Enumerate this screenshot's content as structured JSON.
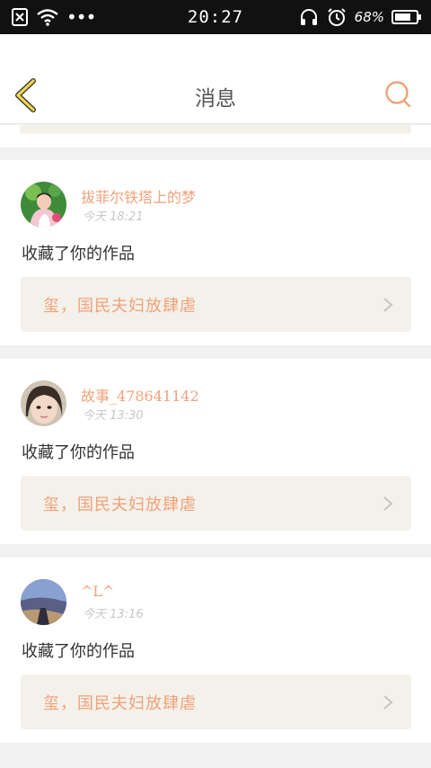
{
  "status_bar": {
    "time": "20:27",
    "battery_text": "68%",
    "icons": [
      "sim-error-icon",
      "wifi-icon",
      "more-dots-icon",
      "headset-icon",
      "alarm-icon",
      "battery-icon"
    ]
  },
  "header": {
    "title": "消息",
    "back_icon": "chevron-left-icon",
    "search_icon": "search-icon"
  },
  "colors": {
    "accent": "#f0a27a",
    "back_arrow": "#f0d84a",
    "card_box": "#f3f1ea",
    "background": "#f1f1f1"
  },
  "messages": [
    {
      "username": "拔菲尔铁塔上的梦",
      "time": "今天 18:21",
      "action": "收藏了你的作品",
      "work_title": "玺，国民夫妇放肆虐"
    },
    {
      "username": "故事_478641142",
      "time": "今天 13:30",
      "action": "收藏了你的作品",
      "work_title": "玺，国民夫妇放肆虐"
    },
    {
      "username": "^L^",
      "time": "今天 13:16",
      "action": "收藏了你的作品",
      "work_title": "玺，国民夫妇放肆虐"
    }
  ]
}
